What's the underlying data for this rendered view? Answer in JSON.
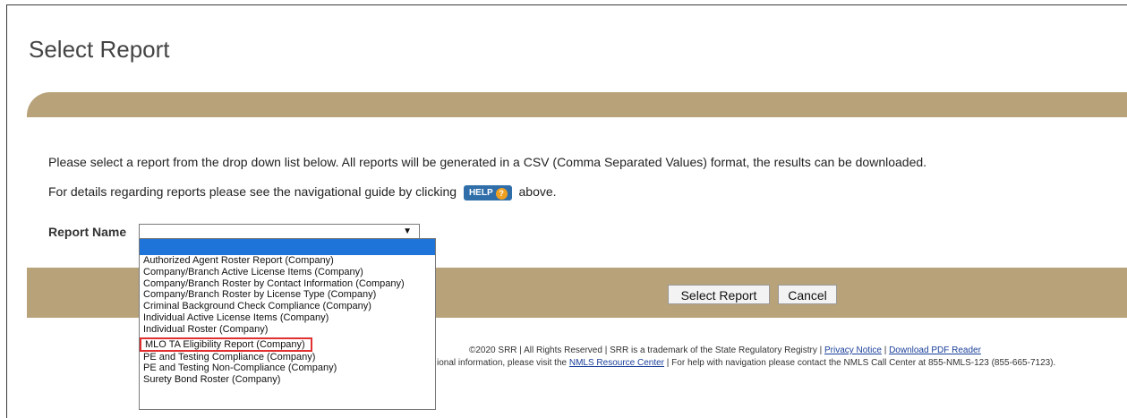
{
  "page": {
    "title": "Select Report"
  },
  "instructions": {
    "line1": "Please select a report from the drop down list below. All reports will be generated in a CSV (Comma Separated Values) format, the results can be downloaded.",
    "line2_before": "For details regarding reports please see the navigational guide by clicking",
    "help_label": "HELP",
    "help_q": "?",
    "line2_after": "above."
  },
  "report": {
    "label": "Report Name",
    "selected": "",
    "options": [
      "Authorized Agent Roster Report (Company)",
      "Company/Branch Active License Items (Company)",
      "Company/Branch Roster by Contact Information (Company)",
      "Company/Branch Roster by License Type (Company)",
      "Criminal Background Check Compliance (Company)",
      "Individual Active License Items (Company)",
      "Individual Roster (Company)",
      "MLO TA Eligibility Report (Company)",
      "PE and Testing Compliance (Company)",
      "PE and Testing Non-Compliance (Company)",
      "Surety Bond Roster (Company)"
    ]
  },
  "buttons": {
    "select": "Select Report",
    "cancel": "Cancel"
  },
  "footer": {
    "line1_text": "©2020 SRR | All Rights Reserved | SRR is a trademark of the State Regulatory Registry |",
    "privacy": "Privacy Notice",
    "sep": "|",
    "pdf": "Download PDF Reader",
    "line2_start": "ional information, please visit the",
    "resource": "NMLS Resource Center",
    "line2_end": "| For help with navigation please contact the NMLS Call Center at 855-NMLS-123 (855-665-7123)."
  },
  "colors": {
    "band": "#b8a27a",
    "highlight": "#1e74d8",
    "callout": "#e03030"
  }
}
